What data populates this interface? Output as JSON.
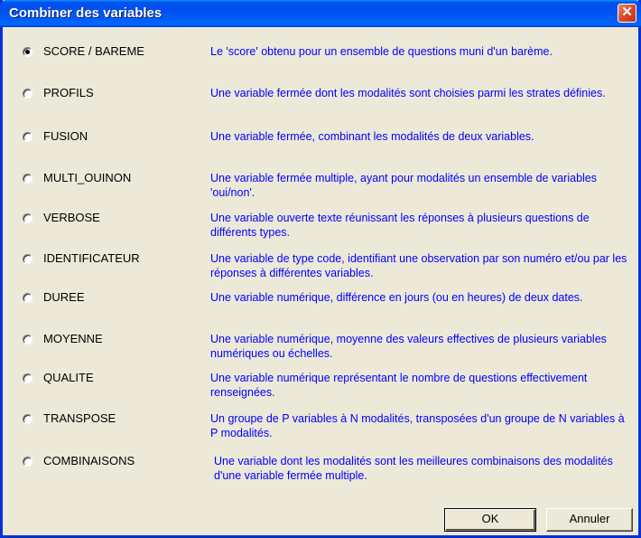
{
  "window": {
    "title": "Combiner des variables"
  },
  "options": [
    {
      "label": "SCORE / BAREME",
      "checked": true,
      "description": "Le 'score' obtenu pour un ensemble de questions muni d'un barème."
    },
    {
      "label": "PROFILS",
      "checked": false,
      "description": "Une variable fermée dont les modalités sont choisies parmi les strates définies."
    },
    {
      "label": "FUSION",
      "checked": false,
      "description": "Une variable fermée, combinant les modalités de deux variables."
    },
    {
      "label": "MULTI_OUINON",
      "checked": false,
      "description": "Une variable fermée multiple, ayant pour modalités un ensemble de variables 'oui/non'."
    },
    {
      "label": "VERBOSE",
      "checked": false,
      "description": "Une variable ouverte texte réunissant les réponses à plusieurs questions de différents types."
    },
    {
      "label": "IDENTIFICATEUR",
      "checked": false,
      "description": "Une variable de type code, identifiant une observation par son numéro et/ou par les réponses à différentes variables."
    },
    {
      "label": "DUREE",
      "checked": false,
      "description": "Une variable numérique, différence en jours (ou en heures) de deux dates."
    },
    {
      "label": "MOYENNE",
      "checked": false,
      "description": "Une variable numérique, moyenne des valeurs effectives de plusieurs variables numériques ou échelles."
    },
    {
      "label": "QUALITE",
      "checked": false,
      "description": "Une variable numérique représentant le nombre de questions effectivement renseignées."
    },
    {
      "label": "TRANSPOSE",
      "checked": false,
      "description": "Un groupe de P variables à N modalités, transposées d'un groupe de N variables à P modalités."
    },
    {
      "label": "COMBINAISONS",
      "checked": false,
      "description": "Une variable dont les modalités sont les meilleures combinaisons des modalités d'une variable fermée multiple."
    }
  ],
  "buttons": {
    "ok": "OK",
    "cancel": "Annuler"
  },
  "icons": {
    "close": "close-icon"
  },
  "colors": {
    "description_text": "#0000ff",
    "titlebar": "#0053ee",
    "close_button": "#d9492e"
  }
}
